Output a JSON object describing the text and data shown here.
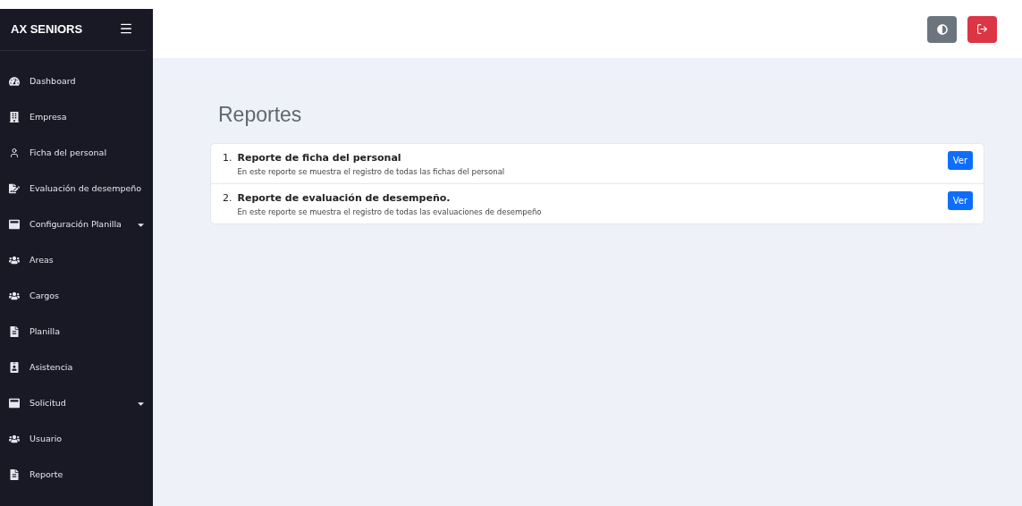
{
  "sidebar": {
    "brand": "AX SENIORS",
    "items": [
      {
        "label": "Dashboard",
        "dropdown": false
      },
      {
        "label": "Empresa",
        "dropdown": false
      },
      {
        "label": "Ficha del personal",
        "dropdown": false
      },
      {
        "label": "Evaluación de desempeño",
        "dropdown": false
      },
      {
        "label": "Configuración Planilla",
        "dropdown": true
      },
      {
        "label": "Areas",
        "dropdown": false
      },
      {
        "label": "Cargos",
        "dropdown": false
      },
      {
        "label": "Planilla",
        "dropdown": false
      },
      {
        "label": "Asistencia",
        "dropdown": false
      },
      {
        "label": "Solicitud",
        "dropdown": true
      },
      {
        "label": "Usuario",
        "dropdown": false
      },
      {
        "label": "Reporte",
        "dropdown": false
      }
    ]
  },
  "page": {
    "title": "Reportes",
    "reports": [
      {
        "number": "1.",
        "title": "Reporte de ficha del personal",
        "description": "En este reporte se muestra el registro de todas las fichas del personal",
        "button": "Ver"
      },
      {
        "number": "2.",
        "title": "Reporte de evaluación de desempeño.",
        "description": "En este reporte se muestra el registro de todas las evaluaciones de desempeño",
        "button": "Ver"
      }
    ]
  }
}
